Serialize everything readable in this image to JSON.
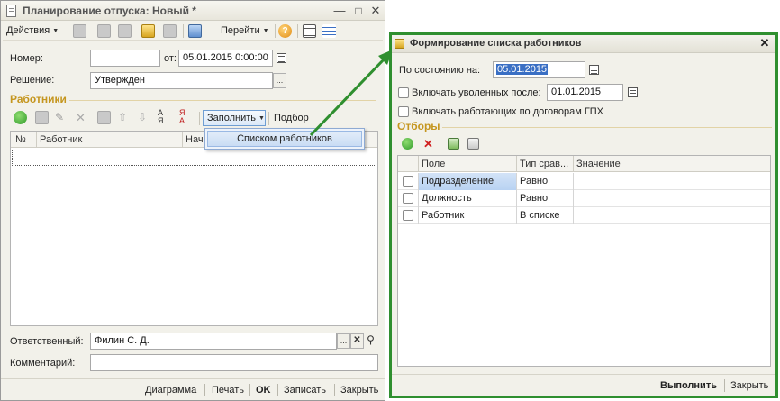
{
  "left_window": {
    "title": "Планирование отпуска: Новый *",
    "toolbar": {
      "actions": "Действия",
      "goto": "Перейти"
    },
    "number_label": "Номер:",
    "number_value": "",
    "date_label": "от:",
    "date_value": "05.01.2015  0:00:00",
    "decision_label": "Решение:",
    "decision_value": "Утвержден",
    "employees_section": "Работники",
    "fill_button": "Заполнить",
    "select_button": "Подбор",
    "fill_menu_item": "Списком работников",
    "table_columns": [
      "№",
      "Работник",
      "Нач"
    ],
    "responsible_label": "Ответственный:",
    "responsible_value": "Филин С. Д.",
    "comment_label": "Комментарий:",
    "comment_value": "",
    "bottom_buttons": [
      "Диаграмма",
      "Печать",
      "OK",
      "Записать",
      "Закрыть"
    ]
  },
  "right_window": {
    "title": "Формирование списка работников",
    "as_of_label": "По состоянию на:",
    "as_of_value": "05.01.2015",
    "include_fired_label": "Включать уволенных после:",
    "include_fired_date": "01.01.2015",
    "include_gph_label": "Включать работающих по договорам ГПХ",
    "filters_section": "Отборы",
    "table_columns": [
      "Поле",
      "Тип срав...",
      "Значение"
    ],
    "rows": [
      {
        "field": "Подразделение",
        "compare": "Равно",
        "value": ""
      },
      {
        "field": "Должность",
        "compare": "Равно",
        "value": ""
      },
      {
        "field": "Работник",
        "compare": "В списке",
        "value": ""
      }
    ],
    "execute_button": "Выполнить",
    "close_button": "Закрыть"
  },
  "colors": {
    "frame_green": "#2f8f2f",
    "section_gold": "#c5961f",
    "selection_blue": "#b8d2f2"
  }
}
